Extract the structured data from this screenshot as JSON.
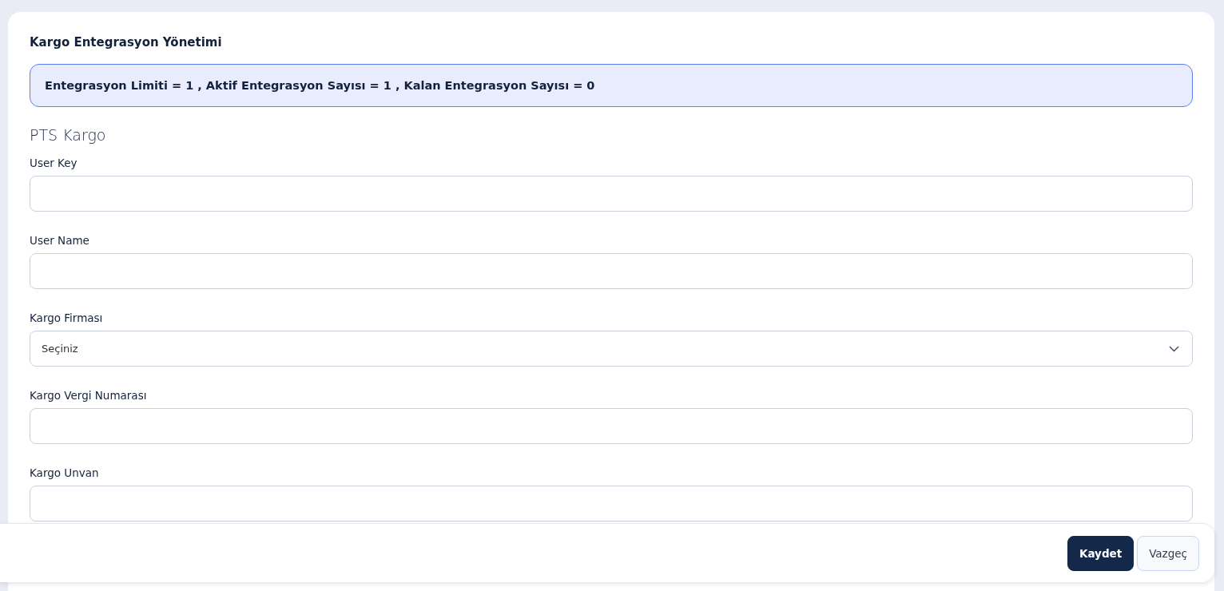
{
  "page_title": "Kargo Entegrasyon Yönetimi",
  "info_banner": "Entegrasyon Limiti = 1 , Aktif Entegrasyon Sayısı = 1 , Kalan Entegrasyon Sayısı = 0",
  "section_title": "PTS Kargo",
  "fields": [
    {
      "kind": "text",
      "label": "User Key"
    },
    {
      "kind": "text",
      "label": "User Name"
    },
    {
      "kind": "select",
      "label": "Kargo Firması",
      "value": "Seçiniz"
    },
    {
      "kind": "text",
      "label": "Kargo Vergi Numarası"
    },
    {
      "kind": "text",
      "label": "Kargo Unvan"
    }
  ],
  "buttons": [
    {
      "kind": "primary",
      "label": "Kaydet"
    },
    {
      "kind": "secondary",
      "label": "Vazgeç"
    }
  ]
}
